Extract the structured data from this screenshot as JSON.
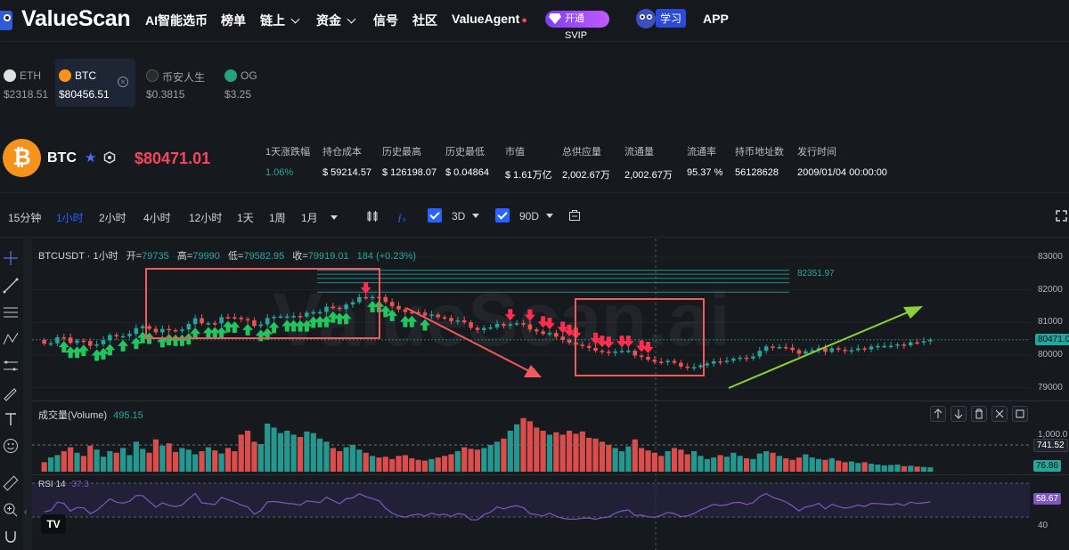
{
  "nav": {
    "brand": "ValueScan",
    "items": [
      "AI智能选币",
      "榜单",
      "链上",
      "资金",
      "信号",
      "社区",
      "ValueAgent"
    ],
    "svip_label": "开通 SVIP",
    "study_label": "学习",
    "app_label": "APP"
  },
  "coin_tabs": [
    {
      "name": "ETH",
      "value": "$2318.51",
      "color": "#e0e0e0",
      "active": false
    },
    {
      "name": "BTC",
      "value": "$80456.51",
      "color": "#f7931a",
      "active": true
    },
    {
      "name": "币安人生",
      "value": "$0.3815",
      "color": "#222222",
      "active": false
    },
    {
      "name": "OG",
      "value": "$3.25",
      "color": "#26a17b",
      "active": false
    }
  ],
  "coin": {
    "symbol": "BTC",
    "icon": "bitcoin-icon",
    "price": "$80471.01",
    "stats": [
      {
        "label": "1天涨跌幅",
        "value": "1.06%"
      },
      {
        "label": "持仓成本",
        "value": "$ 59214.57"
      },
      {
        "label": "历史最高",
        "value": "$ 126198.07"
      },
      {
        "label": "历史最低",
        "value": "$ 0.04864"
      },
      {
        "label": "市值",
        "value": "$ 1.61万亿"
      },
      {
        "label": "总供应量",
        "value": "2,002.67万"
      },
      {
        "label": "流通量",
        "value": "2,002.67万"
      },
      {
        "label": "流通率",
        "value": "95.37 %"
      },
      {
        "label": "持币地址数",
        "value": "56128628"
      },
      {
        "label": "发行时间",
        "value": "2009/01/04 00:00:00"
      }
    ]
  },
  "toolbar": {
    "timeframes": [
      "15分钟",
      "1小时",
      "2小时",
      "4小时",
      "12小时",
      "1天",
      "1周",
      "1月"
    ],
    "active_timeframe": "1小时",
    "check1_label": "3D",
    "check2_label": "90D"
  },
  "chart": {
    "legend": {
      "symbol": "BTCUSDT · 1小时",
      "open_label": "开=",
      "open": "79735",
      "high_label": "高=",
      "high": "79990",
      "low_label": "低=",
      "low": "79582.95",
      "close_label": "收=",
      "close": "79919.01",
      "change": "184 (+0.23%)"
    },
    "resistance_label": "82351.97",
    "current_price_tag": "80471.0",
    "watermark": "ValueScan.ai",
    "volume_label": "成交量(Volume)",
    "volume_value": "495.15",
    "volume_tag1": "741.52",
    "volume_tag2": "76.86",
    "volume_axis_label": "1,000.0",
    "rsi_label": "RSI 14",
    "rsi_value": "37.3",
    "rsi_tag": "58.67",
    "rsi_axis_label": "40",
    "colors": {
      "up": "#26a69a",
      "down": "#ef5350",
      "annotation": "#f05a5a",
      "trend": "#8bd13a"
    }
  },
  "chart_data": {
    "type": "candlestick",
    "title": "BTCUSDT · 1小时",
    "y_ticks": [
      83000,
      82000,
      81000,
      80000,
      79000
    ],
    "ylim": [
      78800,
      83300
    ],
    "open": [
      80465,
      80348,
      80361,
      80547,
      80542,
      80374,
      80444,
      80432,
      80285,
      80330,
      80455,
      80615,
      80576,
      80581,
      80651,
      80827,
      80886,
      80806,
      80699,
      80801,
      80765,
      80744,
      80787,
      80952,
      81131,
      80974,
      80978,
      80973,
      81164,
      81160,
      81147,
      81101,
      81068,
      80890,
      80941,
      81135,
      81176,
      81187,
      81188,
      81198,
      81182,
      81298,
      81314,
      81320,
      81483,
      81452,
      81411,
      81551,
      81620,
      81776,
      81774,
      81783,
      81778,
      81629,
      81503,
      81402,
      81319,
      81318,
      81302,
      81212,
      81242,
      81160,
      81139,
      81041,
      81066,
      81006,
      80838,
      80767,
      80830,
      80850,
      80954,
      80904,
      80947,
      80975,
      80937,
      80786,
      80728,
      80652,
      80677,
      80564,
      80466,
      80383,
      80320,
      80280,
      80222,
      80133,
      80103,
      80066,
      80109,
      80131,
      80134,
      79985,
      79946,
      79861,
      79795,
      79790,
      79821,
      79764,
      79649,
      79618,
      79631,
      79687,
      79739,
      79811,
      79794,
      79826,
      79890,
      79923,
      79896,
      79957,
      80131,
      80264,
      80241,
      80247,
      80227,
      80154,
      80041,
      80119,
      80148,
      80216,
      80101,
      80208,
      80165,
      80129,
      80151,
      80205,
      80176,
      80259,
      80276,
      80281,
      80285,
      80326,
      80300,
      80393,
      80387,
      80424
    ],
    "close": [
      80348,
      80361,
      80547,
      80542,
      80374,
      80444,
      80432,
      80285,
      80330,
      80455,
      80615,
      80576,
      80581,
      80651,
      80827,
      80886,
      80806,
      80699,
      80801,
      80765,
      80744,
      80787,
      80952,
      81131,
      80974,
      80978,
      80973,
      81164,
      81160,
      81147,
      81101,
      81068,
      80890,
      80941,
      81135,
      81176,
      81187,
      81188,
      81198,
      81182,
      81298,
      81314,
      81320,
      81483,
      81452,
      81411,
      81551,
      81620,
      81776,
      81774,
      81783,
      81778,
      81629,
      81503,
      81402,
      81319,
      81318,
      81302,
      81212,
      81242,
      81160,
      81139,
      81041,
      81066,
      81006,
      80838,
      80767,
      80830,
      80850,
      80954,
      80904,
      80947,
      80975,
      80937,
      80786,
      80728,
      80652,
      80677,
      80564,
      80466,
      80383,
      80320,
      80280,
      80222,
      80133,
      80103,
      80066,
      80109,
      80131,
      80134,
      79985,
      79946,
      79861,
      79795,
      79790,
      79821,
      79764,
      79649,
      79618,
      79631,
      79687,
      79739,
      79811,
      79794,
      79826,
      79890,
      79923,
      79896,
      79957,
      80131,
      80264,
      80241,
      80247,
      80227,
      80154,
      80041,
      80119,
      80148,
      80216,
      80101,
      80208,
      80165,
      80129,
      80151,
      80205,
      80176,
      80259,
      80276,
      80281,
      80285,
      80326,
      80300,
      80393,
      80387,
      80424,
      80471
    ],
    "volume": [
      120,
      180,
      210,
      260,
      310,
      240,
      200,
      330,
      280,
      190,
      260,
      240,
      300,
      210,
      380,
      290,
      240,
      410,
      330,
      360,
      250,
      300,
      280,
      220,
      260,
      310,
      270,
      230,
      300,
      260,
      470,
      520,
      380,
      350,
      610,
      560,
      490,
      520,
      470,
      440,
      510,
      490,
      420,
      380,
      300,
      260,
      310,
      340,
      280,
      240,
      200,
      180,
      190,
      160,
      200,
      210,
      170,
      150,
      140,
      160,
      180,
      200,
      220,
      260,
      310,
      290,
      280,
      300,
      340,
      380,
      420,
      520,
      600,
      680,
      640,
      560,
      520,
      470,
      500,
      470,
      520,
      480,
      510,
      430,
      420,
      380,
      340,
      300,
      260,
      320,
      410,
      300,
      270,
      240,
      200,
      260,
      300,
      280,
      220,
      260,
      200,
      160,
      180,
      210,
      190,
      240,
      200,
      170,
      160,
      230,
      260,
      240,
      200,
      170,
      150,
      180,
      220,
      180,
      160,
      150,
      170,
      140,
      120,
      130,
      110,
      120,
      100,
      90,
      80,
      85,
      90,
      70,
      75,
      65,
      60,
      55
    ],
    "annotations": [
      "rectangle: consolidation zone (left)",
      "rectangle: consolidation zone (right)",
      "red arrow: downtrend",
      "green arrow: uptrend"
    ]
  },
  "icons": {
    "crosshair": "crosshair-icon",
    "line": "trendline-icon",
    "fib": "fib-icon",
    "pattern": "pattern-icon",
    "measure": "measure-icon",
    "brush": "brush-icon",
    "text": "text-icon",
    "emoji": "emoji-icon",
    "ruler": "ruler-icon",
    "zoom": "zoom-icon"
  }
}
